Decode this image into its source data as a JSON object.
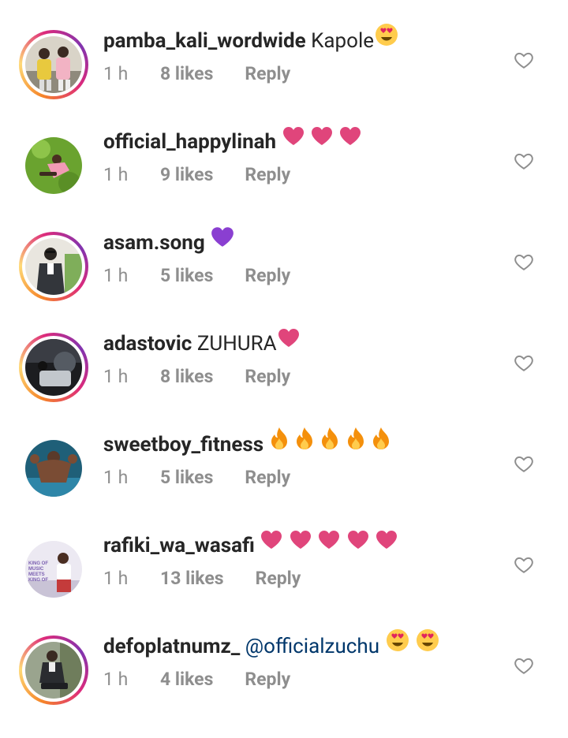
{
  "comments": [
    {
      "username": "pamba_kali_wordwide",
      "text": "Kapole",
      "mention": "",
      "emojis": [
        "heart-eyes-emoji"
      ],
      "time": "1 h",
      "likes": "8 likes",
      "reply": "Reply",
      "story_ring": true
    },
    {
      "username": "official_happylinah",
      "text": "",
      "mention": "",
      "emojis": [
        "pink-heart-emoji",
        "pink-heart-emoji",
        "pink-heart-emoji"
      ],
      "time": "1 h",
      "likes": "9 likes",
      "reply": "Reply",
      "story_ring": false
    },
    {
      "username": "asam.song",
      "text": "",
      "mention": "",
      "emojis": [
        "purple-heart-emoji"
      ],
      "time": "1 h",
      "likes": "5 likes",
      "reply": "Reply",
      "story_ring": true
    },
    {
      "username": "adastovic",
      "text": "ZUHURA",
      "mention": "",
      "emojis": [
        "pink-heart-emoji"
      ],
      "time": "1 h",
      "likes": "8 likes",
      "reply": "Reply",
      "story_ring": true
    },
    {
      "username": "sweetboy_fitness",
      "text": "",
      "mention": "",
      "emojis": [
        "fire-emoji",
        "fire-emoji",
        "fire-emoji",
        "fire-emoji",
        "fire-emoji"
      ],
      "time": "1 h",
      "likes": "5 likes",
      "reply": "Reply",
      "story_ring": false
    },
    {
      "username": "rafiki_wa_wasafi",
      "text": "",
      "mention": "",
      "emojis": [
        "pink-heart-emoji",
        "pink-heart-emoji",
        "pink-heart-emoji",
        "pink-heart-emoji",
        "pink-heart-emoji"
      ],
      "time": "1 h",
      "likes": "13 likes",
      "reply": "Reply",
      "story_ring": false,
      "avatar_text": "KING OF MUSIC MEETS KING OF"
    },
    {
      "username": "defoplatnumz_",
      "text": "",
      "mention": "@officialzuchu",
      "emojis": [
        "heart-eyes-emoji",
        "heart-eyes-emoji"
      ],
      "time": "1 h",
      "likes": "4 likes",
      "reply": "Reply",
      "story_ring": true
    }
  ],
  "icons": {
    "like": "heart-outline-icon"
  },
  "colors": {
    "username": "#262626",
    "meta": "#8e8e8e",
    "mention": "#00376b",
    "pink_heart": "#e0457b",
    "purple_heart": "#8a3fd1",
    "fire": "#f4900c"
  }
}
